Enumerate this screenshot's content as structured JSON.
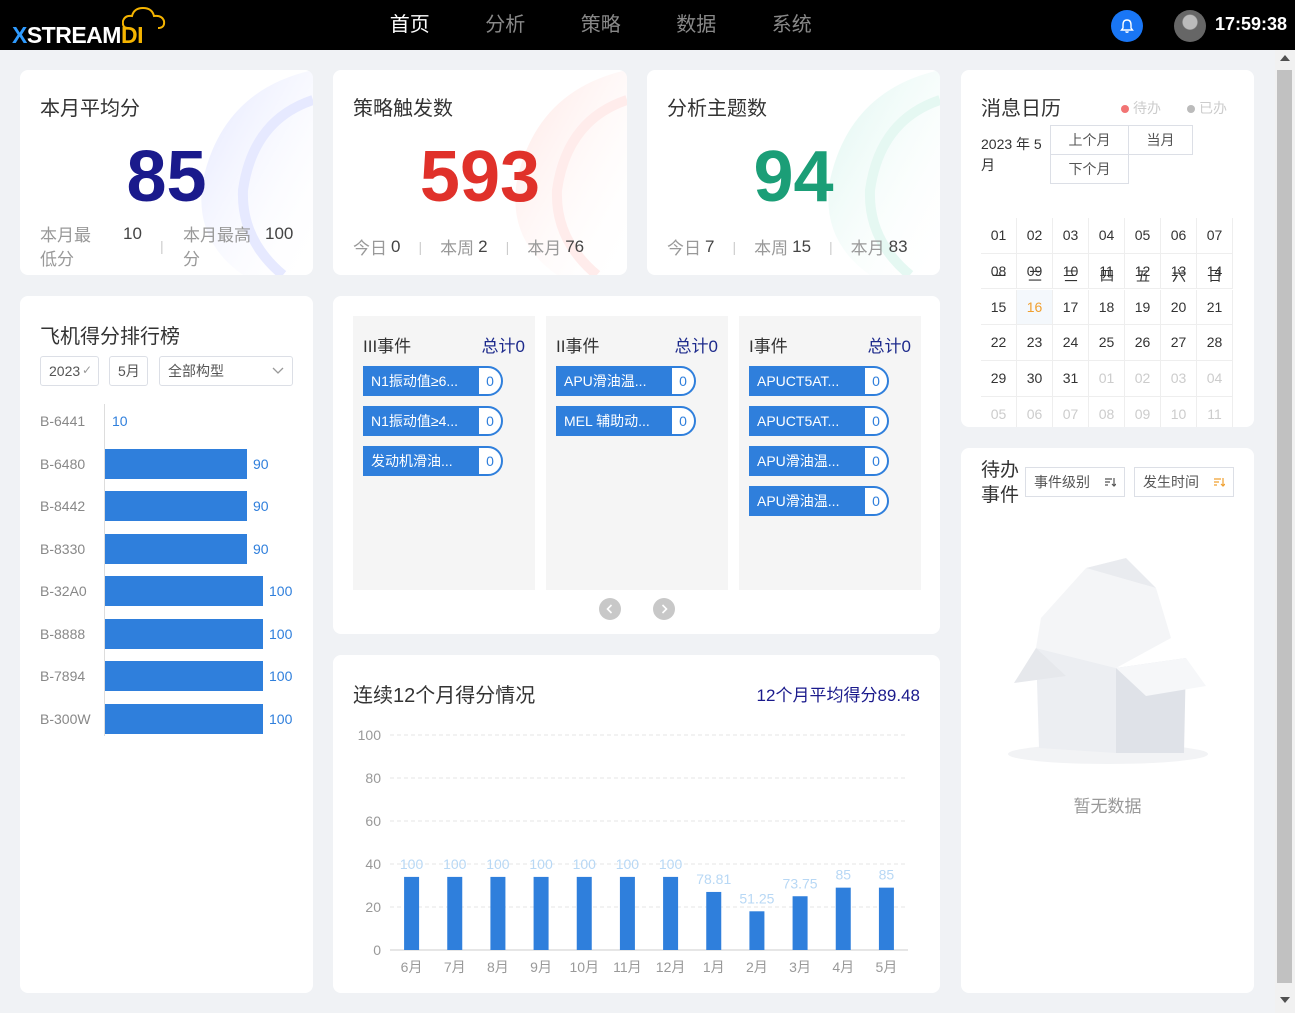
{
  "header": {
    "logo_prefix": "X",
    "logo_main": "STREAM",
    "logo_suffix": "DI",
    "nav": [
      "首页",
      "分析",
      "策略",
      "数据",
      "系统"
    ],
    "active_nav": "首页",
    "time": "17:59:38",
    "bell_icon": "bell-icon",
    "avatar_icon": "user-avatar-icon"
  },
  "colors": {
    "primary": "#2f7fdc",
    "navy": "#1a1a8c",
    "red": "#e0312a",
    "green": "#1b9e77",
    "orange": "#f0a030"
  },
  "stats": {
    "avg": {
      "title": "本月平均分",
      "value": "85",
      "low_label": "本月最低分",
      "low_value": "10",
      "high_label": "本月最高分",
      "high_value": "100"
    },
    "trigger": {
      "title": "策略触发数",
      "value": "593",
      "today_label": "今日",
      "today": "0",
      "week_label": "本周",
      "week": "2",
      "month_label": "本月",
      "month": "76"
    },
    "topics": {
      "title": "分析主题数",
      "value": "94",
      "today_label": "今日",
      "today": "7",
      "week_label": "本周",
      "week": "15",
      "month_label": "本月",
      "month": "83"
    }
  },
  "ranking": {
    "title": "飞机得分排行榜",
    "year": "2023",
    "month": "5月",
    "type": "全部构型",
    "items": [
      {
        "name": "B-6441",
        "value": 10
      },
      {
        "name": "B-6480",
        "value": 90
      },
      {
        "name": "B-8442",
        "value": 90
      },
      {
        "name": "B-8330",
        "value": 90
      },
      {
        "name": "B-32A0",
        "value": 100
      },
      {
        "name": "B-8888",
        "value": 100
      },
      {
        "name": "B-7894",
        "value": 100
      },
      {
        "name": "B-300W",
        "value": 100
      }
    ]
  },
  "events": {
    "columns": [
      {
        "title": "III事件",
        "total": "总计0",
        "items": [
          {
            "label": "N1振动值≥6...",
            "count": "0"
          },
          {
            "label": "N1振动值≥4...",
            "count": "0"
          },
          {
            "label": "发动机滑油...",
            "count": "0"
          }
        ]
      },
      {
        "title": "II事件",
        "total": "总计0",
        "items": [
          {
            "label": "APU滑油温...",
            "count": "0"
          },
          {
            "label": "MEL 辅助动...",
            "count": "0"
          }
        ]
      },
      {
        "title": "I事件",
        "total": "总计0",
        "items": [
          {
            "label": "APUCT5AT...",
            "count": "0"
          },
          {
            "label": "APUCT5AT...",
            "count": "0"
          },
          {
            "label": "APU滑油温...",
            "count": "0"
          },
          {
            "label": "APU滑油温...",
            "count": "0"
          }
        ]
      }
    ]
  },
  "trend": {
    "title": "连续12个月得分情况",
    "avg_text": "12个月平均得分89.48"
  },
  "chart_data": {
    "type": "bar",
    "categories": [
      "6月",
      "7月",
      "8月",
      "9月",
      "10月",
      "11月",
      "12月",
      "1月",
      "2月",
      "3月",
      "4月",
      "5月"
    ],
    "values": [
      34,
      34,
      34,
      34,
      34,
      34,
      34,
      27,
      18,
      25,
      29,
      29
    ],
    "data_labels": [
      "100",
      "100",
      "100",
      "100",
      "100",
      "100",
      "100",
      "78.81",
      "51.25",
      "73.75",
      "85",
      "85"
    ],
    "yticks": [
      "100",
      "80",
      "60",
      "40",
      "20",
      "0"
    ],
    "ylim": [
      0,
      100
    ],
    "grid": true
  },
  "calendar": {
    "title": "消息日历",
    "legend_todo": "待办",
    "legend_done": "已办",
    "month_label": "2023 年 5 月",
    "prev": "上个月",
    "current": "当月",
    "next": "下个月",
    "weekdays": [
      "一",
      "二",
      "三",
      "四",
      "五",
      "六",
      "日"
    ],
    "days": [
      "01",
      "02",
      "03",
      "04",
      "05",
      "06",
      "07",
      "08",
      "09",
      "10",
      "11",
      "12",
      "13",
      "14",
      "15",
      "16",
      "17",
      "18",
      "19",
      "20",
      "21",
      "22",
      "23",
      "24",
      "25",
      "26",
      "27",
      "28",
      "29",
      "30",
      "31",
      "01",
      "02",
      "03",
      "04",
      "05",
      "06",
      "07",
      "08",
      "09",
      "10",
      "11"
    ],
    "today": "16"
  },
  "todo": {
    "title": "待办事件",
    "sort_level": "事件级别",
    "sort_time": "发生时间",
    "empty": "暂无数据"
  }
}
